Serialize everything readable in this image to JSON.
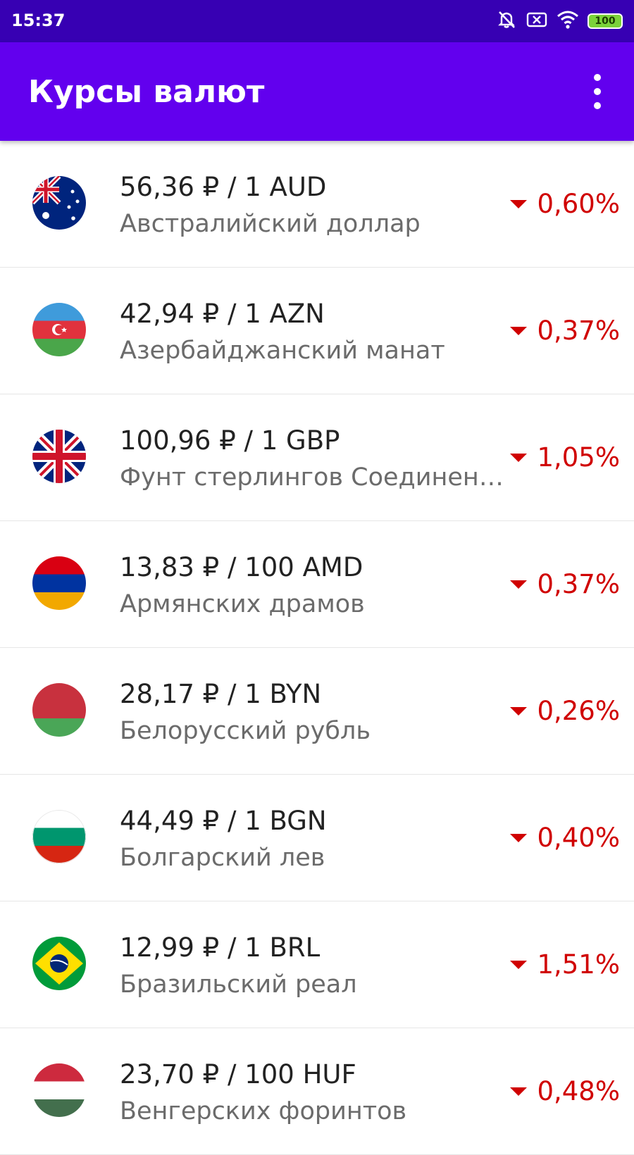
{
  "status_bar": {
    "time": "15:37",
    "battery": "100",
    "icons": [
      "notifications-off-icon",
      "sim-x-icon",
      "wifi-icon",
      "battery-icon"
    ]
  },
  "app_bar": {
    "title": "Курсы валют",
    "menu_icon": "more-vert-icon"
  },
  "colors": {
    "status_bar": "#3700B3",
    "app_bar": "#6200EE",
    "negative": "#D00000"
  },
  "rates": [
    {
      "code": "AUD",
      "rate": "56,36 ₽ / 1 AUD",
      "name": "Австралийский доллар",
      "change": "0,60%",
      "direction": "down",
      "flag_icon": "flag-australia-icon"
    },
    {
      "code": "AZN",
      "rate": "42,94 ₽ / 1 AZN",
      "name": "Азербайджанский манат",
      "change": "0,37%",
      "direction": "down",
      "flag_icon": "flag-azerbaijan-icon"
    },
    {
      "code": "GBP",
      "rate": "100,96 ₽ / 1 GBP",
      "name": "Фунт стерлингов Соединенного королевства",
      "change": "1,05%",
      "direction": "down",
      "flag_icon": "flag-uk-icon"
    },
    {
      "code": "AMD",
      "rate": "13,83 ₽ / 100 AMD",
      "name": "Армянских драмов",
      "change": "0,37%",
      "direction": "down",
      "flag_icon": "flag-armenia-icon"
    },
    {
      "code": "BYN",
      "rate": "28,17 ₽ / 1 BYN",
      "name": "Белорусский рубль",
      "change": "0,26%",
      "direction": "down",
      "flag_icon": "flag-belarus-icon"
    },
    {
      "code": "BGN",
      "rate": "44,49 ₽ / 1 BGN",
      "name": "Болгарский лев",
      "change": "0,40%",
      "direction": "down",
      "flag_icon": "flag-bulgaria-icon"
    },
    {
      "code": "BRL",
      "rate": "12,99 ₽ / 1 BRL",
      "name": "Бразильский реал",
      "change": "1,51%",
      "direction": "down",
      "flag_icon": "flag-brazil-icon"
    },
    {
      "code": "HUF",
      "rate": "23,70 ₽ / 100 HUF",
      "name": "Венгерских форинтов",
      "change": "0,48%",
      "direction": "down",
      "flag_icon": "flag-hungary-icon"
    }
  ]
}
